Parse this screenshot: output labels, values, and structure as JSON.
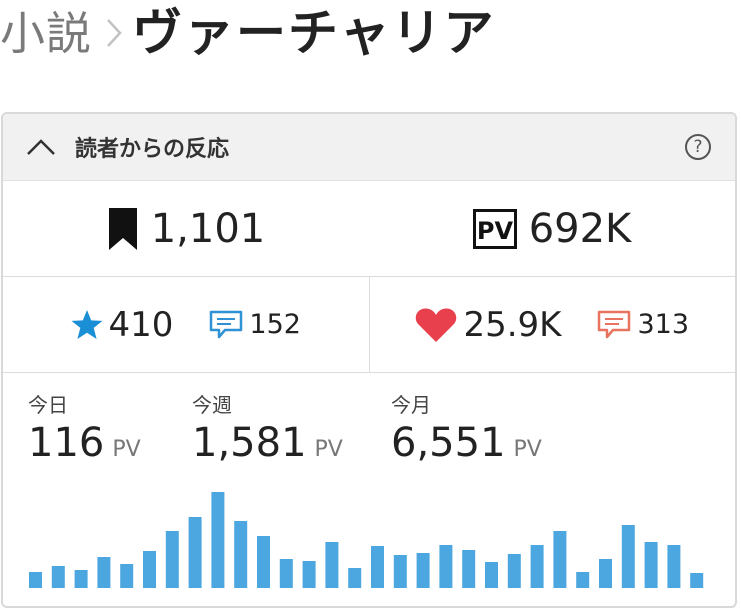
{
  "breadcrumb": {
    "parent": "小説",
    "title": "ヴァーチャリア"
  },
  "panel": {
    "title": "読者からの反応",
    "help_label": "?"
  },
  "summary": {
    "bookmarks": "1,101",
    "pv_total": "692K",
    "stars": "410",
    "star_comments": "152",
    "hearts": "25.9K",
    "heart_comments": "313"
  },
  "pv": {
    "unit": "PV",
    "today": {
      "label": "今日",
      "value": "116"
    },
    "week": {
      "label": "今週",
      "value": "1,581"
    },
    "month": {
      "label": "今月",
      "value": "6,551"
    }
  },
  "colors": {
    "star": "#1a8fd6",
    "heart": "#e8414d",
    "star_comment": "#2f92d4",
    "heart_comment": "#e8735e",
    "bar": "#4ca6e0"
  },
  "icons": {
    "collapse": "chevron-up-icon",
    "help": "question-circle-icon",
    "bookmark": "bookmark-icon",
    "pv": "pv-badge-icon",
    "star": "star-icon",
    "heart": "heart-icon",
    "comment": "speech-bubble-icon"
  },
  "chart_data": {
    "type": "bar",
    "values": [
      16,
      22,
      18,
      31,
      24,
      37,
      57,
      71,
      96,
      67,
      52,
      29,
      27,
      46,
      20,
      42,
      33,
      35,
      43,
      38,
      26,
      34,
      43,
      57,
      16,
      29,
      63,
      46,
      43,
      15
    ]
  }
}
